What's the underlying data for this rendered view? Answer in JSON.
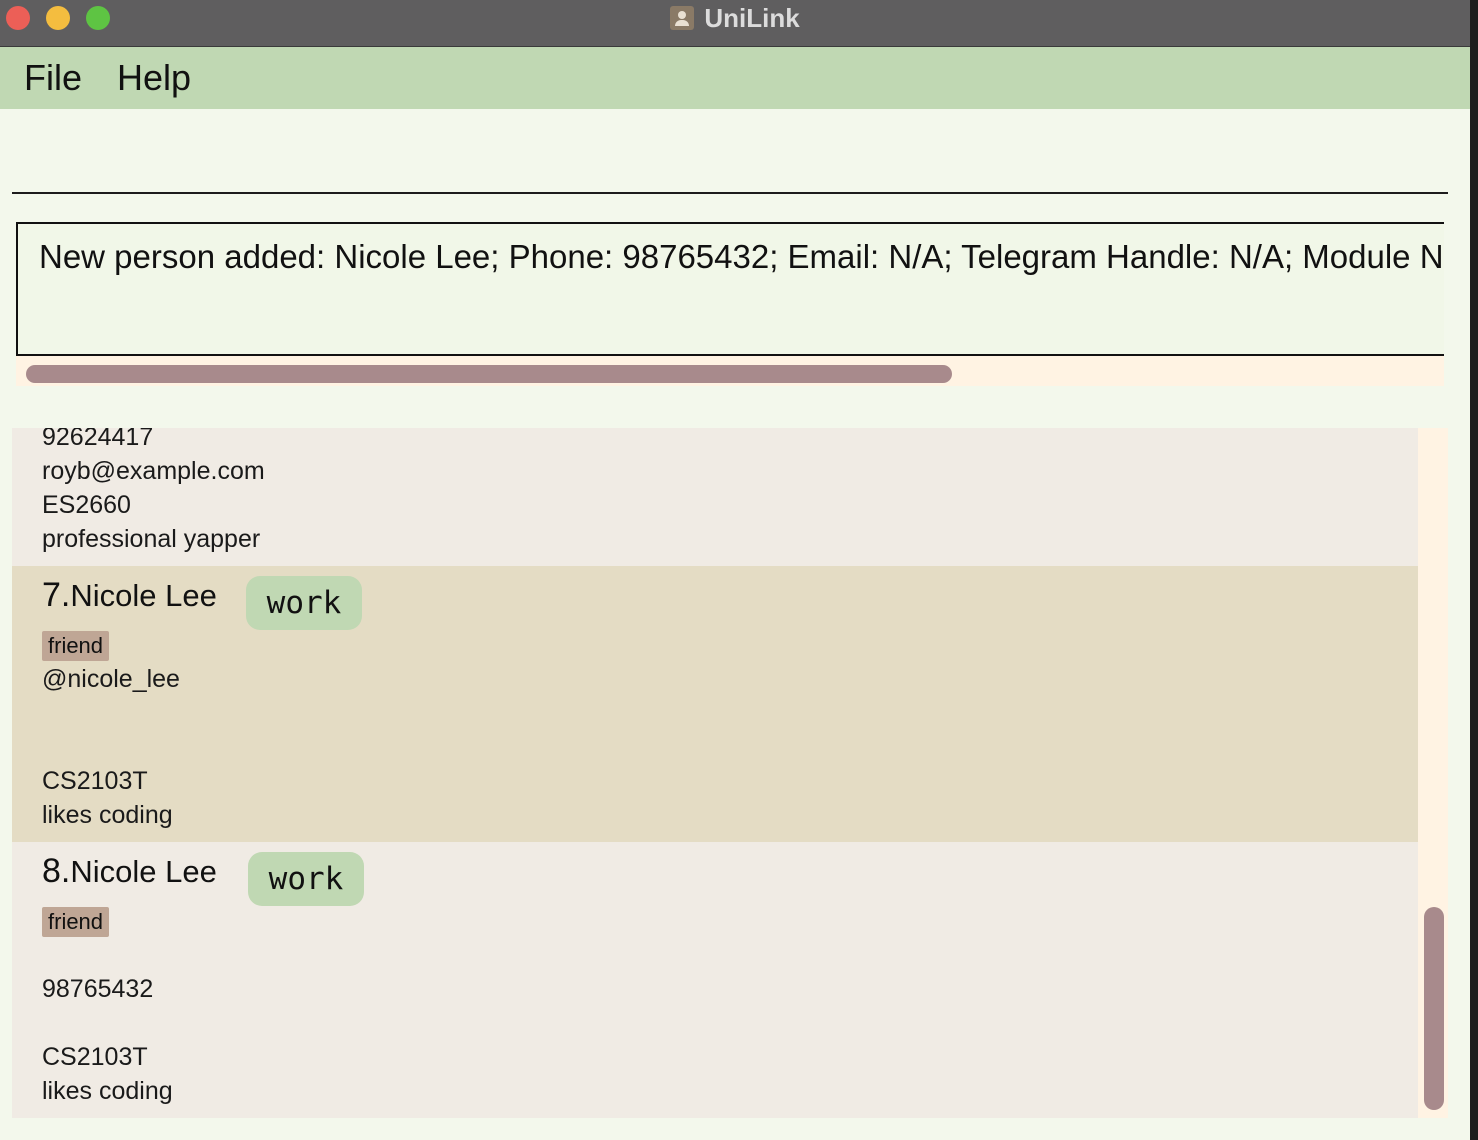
{
  "window": {
    "title": "UniLink"
  },
  "menu": {
    "file": "File",
    "help": "Help"
  },
  "command": {
    "value": "",
    "placeholder": ""
  },
  "result": {
    "message": "New person added: Nicole Lee; Phone: 98765432; Email: N/A; Telegram Handle: N/A; Module Nar"
  },
  "persons": {
    "partial": {
      "phone": "92624417",
      "email": "royb@example.com",
      "module": "ES2660",
      "remark": "professional yapper"
    },
    "p7": {
      "index": "7.",
      "name": "Nicole Lee",
      "group": "work",
      "tag": "friend",
      "telegram": "@nicole_lee",
      "module": "CS2103T",
      "remark": "likes coding"
    },
    "p8": {
      "index": "8.",
      "name": "Nicole Lee",
      "group": "work",
      "tag": "friend",
      "phone": "98765432",
      "module": "CS2103T",
      "remark": "likes coding"
    }
  },
  "colors": {
    "menubar": "#c0d8b3",
    "scroll_thumb": "#a88a8c",
    "card_selected": "#e4dcc4",
    "card_default": "#f0ebe4",
    "tag_friend": "#bfa695"
  },
  "icons": [
    "close-traffic-light",
    "minimize-traffic-light",
    "maximize-traffic-light",
    "app-contact-icon"
  ]
}
